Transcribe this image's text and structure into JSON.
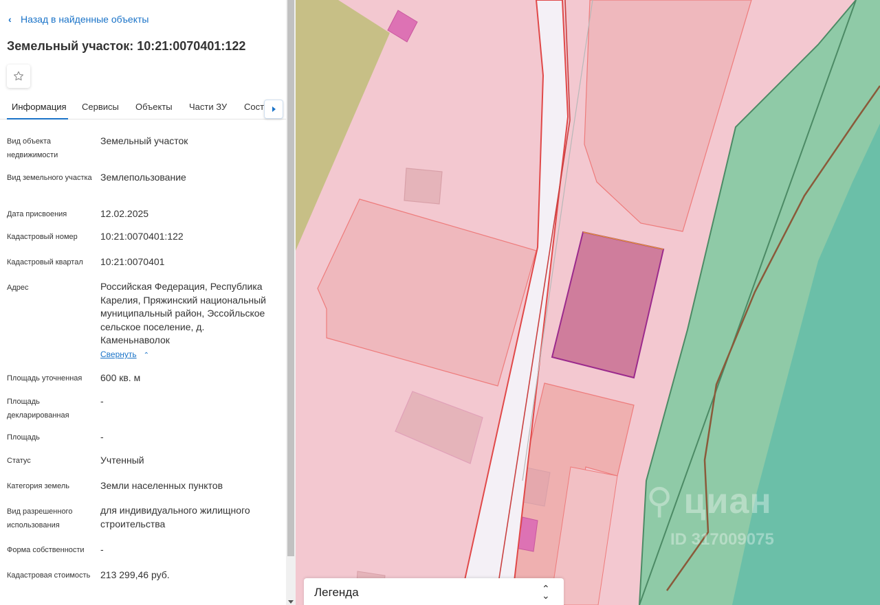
{
  "header": {
    "back_label": "Назад в найденные объекты",
    "title": "Земельный участок: 10:21:0070401:122"
  },
  "tabs": [
    {
      "label": "Информация",
      "active": true
    },
    {
      "label": "Сервисы"
    },
    {
      "label": "Объекты"
    },
    {
      "label": "Части ЗУ"
    },
    {
      "label": "Состав"
    }
  ],
  "properties": [
    {
      "label": "Вид объекта недвижимости",
      "value": "Земельный участок"
    },
    {
      "label": "Вид земельного участка",
      "value": "Землепользование"
    },
    {
      "label": "Дата присвоения",
      "value": "12.02.2025"
    },
    {
      "label": "Кадастровый номер",
      "value": "10:21:0070401:122"
    },
    {
      "label": "Кадастровый квартал",
      "value": "10:21:0070401"
    },
    {
      "label": "Адрес",
      "value": "Российская Федерация, Республика Карелия, Пряжинский национальный муниципальный район, Эссойльское сельское поселение, д. Каменьнаволок"
    },
    {
      "label": "Площадь уточненная",
      "value": "600 кв. м"
    },
    {
      "label": "Площадь декларированная",
      "value": "-"
    },
    {
      "label": "Площадь",
      "value": "-"
    },
    {
      "label": "Статус",
      "value": "Учтенный"
    },
    {
      "label": "Категория земель",
      "value": "Земли населенных пунктов"
    },
    {
      "label": "Вид разрешенного использования",
      "value": "для индивидуального жилищного строительства"
    },
    {
      "label": "Форма собственности",
      "value": "-"
    },
    {
      "label": "Кадастровая стоимость",
      "value": "213 299,46 руб."
    }
  ],
  "address_collapse_label": "Свернуть",
  "map": {
    "watermark_brand": "циан",
    "watermark_id": "ID 317009075",
    "legend_label": "Легенда"
  },
  "colors": {
    "accent": "#1a73c8",
    "map_background": "#f3c8d0",
    "selected_parcel": "#cf7d9c",
    "forest": "#8fcaa7",
    "water": "#6bbfa8"
  },
  "icons": {
    "back": "chevron-left-icon",
    "favorite": "star-outline-icon",
    "tab_scroll": "chevron-right-icon",
    "collapse": "chevron-up-icon",
    "legend_toggle": "chevron-updown-icon"
  }
}
